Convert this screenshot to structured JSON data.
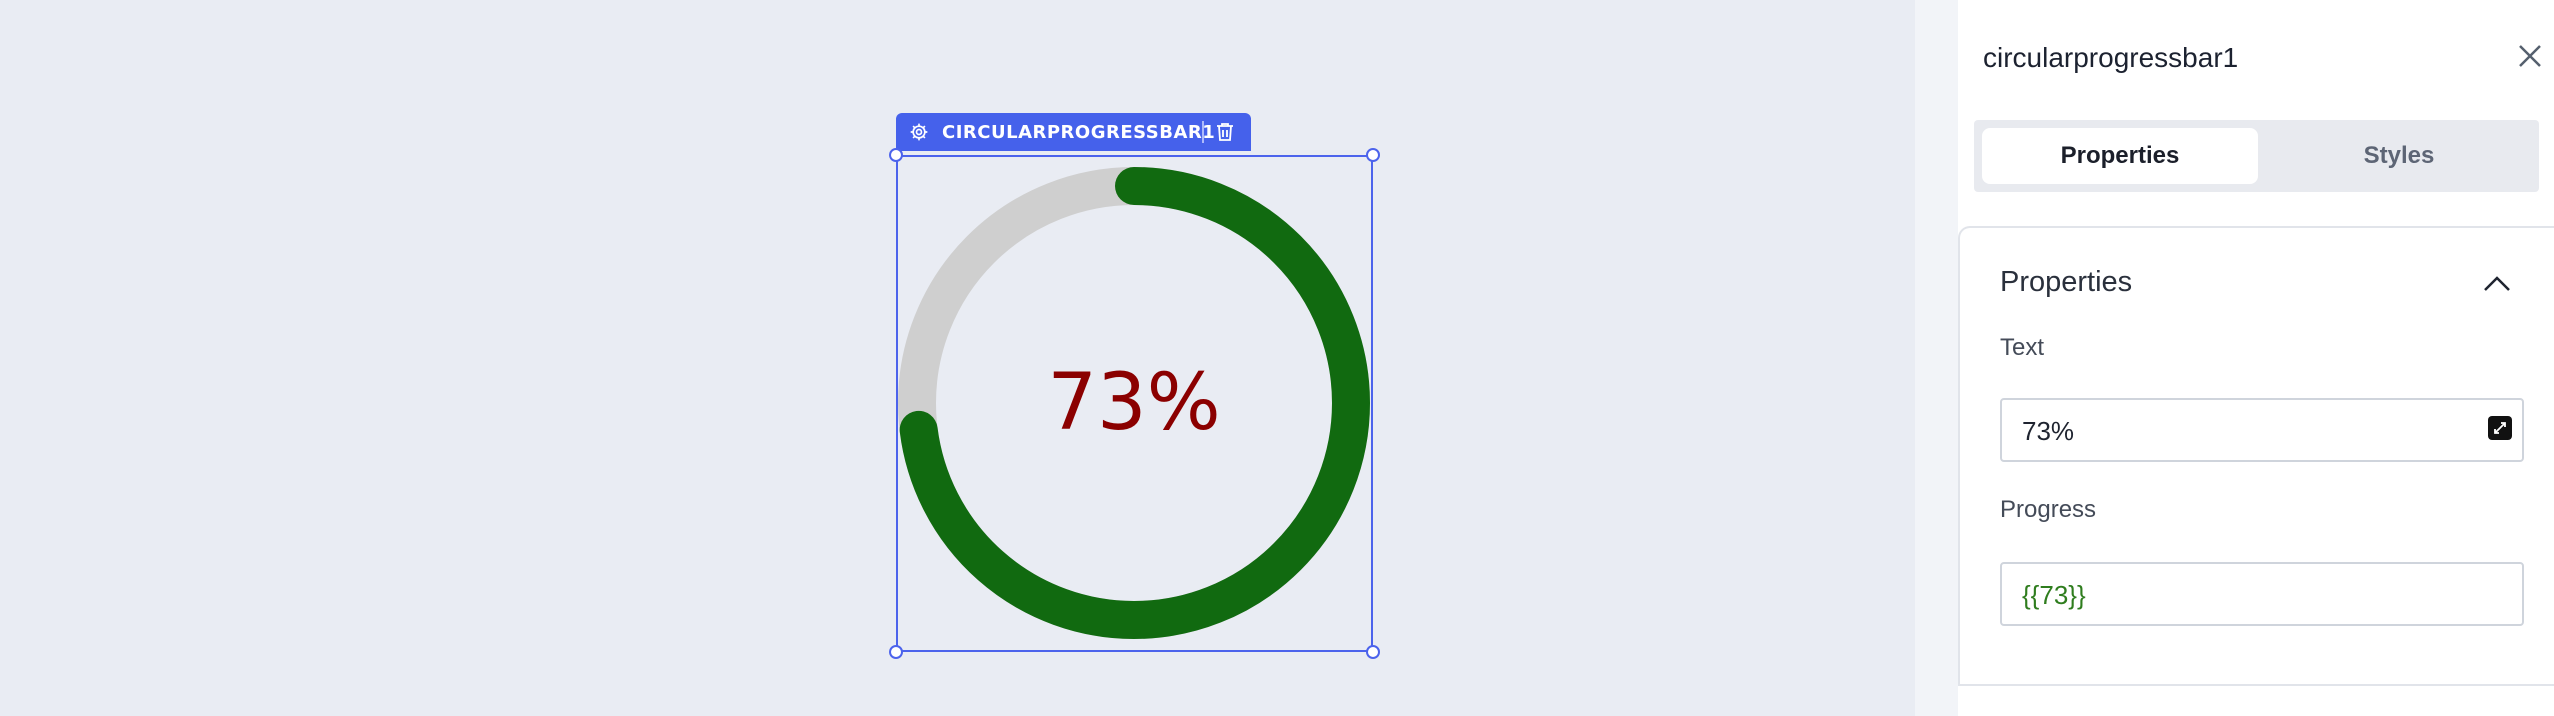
{
  "widget": {
    "label": "CIRCULARPROGRESSBAR1",
    "display_text": "73%",
    "progress_percent": 73,
    "colors": {
      "progress": "#116a10",
      "track": "#cfcfcf",
      "text": "#8b0000",
      "selection": "#4c63ec"
    }
  },
  "panel": {
    "title": "circularprogressbar1",
    "tabs": [
      {
        "label": "Properties",
        "active": true
      },
      {
        "label": "Styles",
        "active": false
      }
    ],
    "section": {
      "title": "Properties",
      "text_label": "Text",
      "text_value": "73%",
      "progress_label": "Progress",
      "progress_value": "{{73}}"
    }
  },
  "icons": {
    "settings": "gear-icon",
    "delete": "trash-icon",
    "close": "close-icon",
    "collapse": "chevron-up-icon",
    "expand": "expand-icon"
  }
}
